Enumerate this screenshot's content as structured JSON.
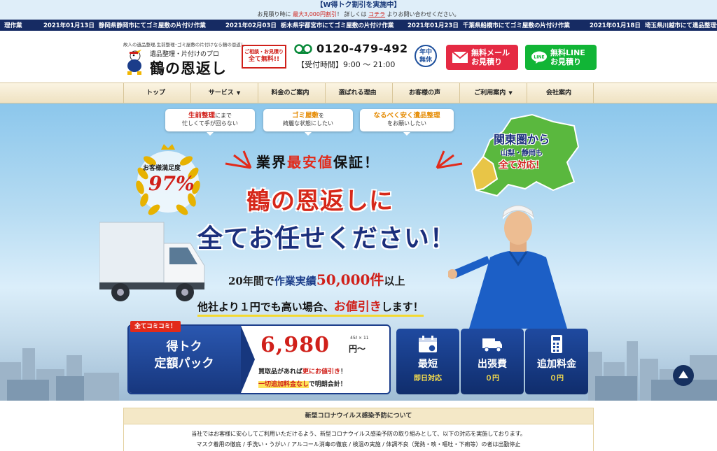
{
  "promo": {
    "title": "【W得トク割引を実施中】",
    "line_prefix": "お見積り時に",
    "line_highlight": "最大3,000円割引",
    "line_mid": "！ 詳しくは",
    "line_link": "コチラ",
    "line_suffix": "よりお問い合わせください。"
  },
  "ticker": [
    {
      "date": "",
      "text": "理作業"
    },
    {
      "date": "2021年01月13日",
      "text": "静岡県静岡市にてゴミ屋敷の片付け作業"
    },
    {
      "date": "2021年02月03日",
      "text": "栃木県宇都宮市にてゴミ屋敷の片付け作業"
    },
    {
      "date": "2021年01月23日",
      "text": "千葉県船橋市にてゴミ屋敷の片付け作業"
    },
    {
      "date": "2021年01月18日",
      "text": "埼玉県川越市にて遺品整理作"
    }
  ],
  "header": {
    "tagline": "故人の遺品整理,生前整理･ゴミ屋敷の片付けなら鶴の恩返し",
    "logo_sub": "遺品整理・片付けのプロ",
    "logo_main": "鶴の恩返し",
    "free_top": "ご相談・お見積り",
    "free_bottom": "全て無料!!",
    "phone": "0120-479-492",
    "hours": "【受付時間】9:00 ～ 21:00",
    "nenju_1": "年中",
    "nenju_2": "無休",
    "mail_1": "無料メール",
    "mail_2": "お見積り",
    "line_1": "無料LINE",
    "line_2": "お見積り"
  },
  "nav": [
    {
      "label": "トップ",
      "caret": ""
    },
    {
      "label": "サービス",
      "caret": "▼"
    },
    {
      "label": "料金のご案内",
      "caret": ""
    },
    {
      "label": "選ばれる理由",
      "caret": ""
    },
    {
      "label": "お客様の声",
      "caret": ""
    },
    {
      "label": "ご利用案内",
      "caret": "▼"
    },
    {
      "label": "会社案内",
      "caret": ""
    }
  ],
  "hero": {
    "bubbles": [
      {
        "hl": "生前整理",
        "rest": "にまで",
        "line2": "忙しくて手が回らない"
      },
      {
        "hl": "ゴミ屋敷",
        "rest": "を",
        "line2": "綺麗な状態にしたい"
      },
      {
        "hl": "なるべく安く遺品整理",
        "rest": "",
        "line2": "をお願いしたい"
      }
    ],
    "satisfaction_label": "お客様満足度",
    "satisfaction_value": "97%",
    "guarantee_a": "業界",
    "guarantee_b": "最安値",
    "guarantee_c": "保証！",
    "headline1": "鶴の恩返しに",
    "headline2": "全てお任せください！",
    "record_a": "20年間で",
    "record_b": "作業実績",
    "record_c": "50,000件",
    "record_d": "以上",
    "discount_a": "他社より１円でも高い場合、",
    "discount_b": "お値引き",
    "discount_c": "します！",
    "kanto_1": "関東圏から",
    "kanto_2": "山梨・静岡も",
    "kanto_3": "全て対応！"
  },
  "pack": {
    "badge": "全てコミコミ！",
    "name_1": "得トク",
    "name_2": "定額パック",
    "size": "45ℓ × 11",
    "price": "6,980",
    "yen": "円～",
    "note1_a": "買取品があれば",
    "note1_b": "更にお値引き",
    "note1_c": "！",
    "note2_a": "一切追加料金なし",
    "note2_b": "で明朗会計！"
  },
  "features": [
    {
      "icon": "calendar-icon",
      "line1": "最短",
      "line2": "即日対応"
    },
    {
      "icon": "truck-icon",
      "line1": "出張費",
      "line2": "０円"
    },
    {
      "icon": "calculator-icon",
      "line1": "追加料金",
      "line2": "０円"
    }
  ],
  "covid": {
    "title": "新型コロナウイルス感染予防について",
    "line1": "当社ではお客様に安心してご利用いただけるよう、新型コロナウイルス感染予防の取り組みとして、以下の対応を実施しております。",
    "line2": "マスク着用の徹底 / 手洗い・うがい / アルコール消毒の徹底 / 検温の実施 / 体調不良（発熱・咳・嘔吐・下痢等）の者は出勤停止"
  },
  "colors": {
    "navy": "#1b2f7c",
    "red": "#d0201a",
    "line_green": "#11b536",
    "mail_red": "#e52a43"
  }
}
